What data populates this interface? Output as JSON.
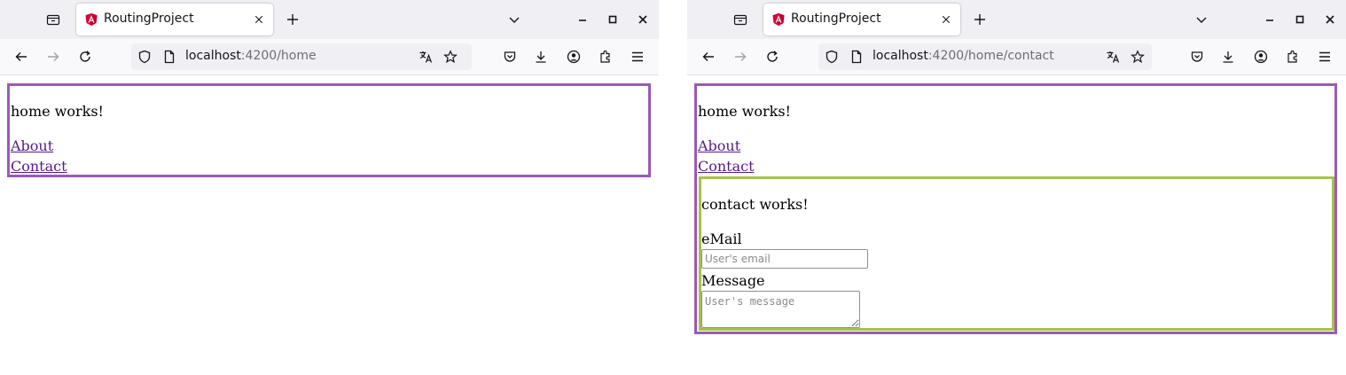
{
  "windows": [
    {
      "tab": {
        "title": "RoutingProject"
      },
      "url": {
        "host": "localhost",
        "rest": ":4200/home"
      },
      "page": {
        "home_text": "home works!",
        "links": [
          "About",
          "Contact"
        ]
      }
    },
    {
      "tab": {
        "title": "RoutingProject"
      },
      "url": {
        "host": "localhost",
        "rest": ":4200/home/contact"
      },
      "page": {
        "home_text": "home works!",
        "links": [
          "About",
          "Contact"
        ],
        "contact": {
          "title": "contact works!",
          "email_label": "eMail",
          "email_placeholder": "User's email",
          "message_label": "Message",
          "message_placeholder": "User's message"
        }
      }
    }
  ],
  "icons": {
    "tab_list": "tab-list-icon",
    "favicon": "angular-logo-icon",
    "close_tab": "close-icon",
    "new_tab": "plus-icon",
    "all_tabs": "chevron-down-icon",
    "minimize": "minimize-icon",
    "maximize": "maximize-icon",
    "close_window": "close-window-icon",
    "back": "back-arrow-icon",
    "forward": "forward-arrow-icon",
    "reload": "reload-icon",
    "shield": "shield-icon",
    "page": "page-icon",
    "translate": "translate-icon",
    "bookmark": "star-icon",
    "pocket": "pocket-icon",
    "downloads": "download-icon",
    "account": "account-icon",
    "extensions": "extensions-icon",
    "menu": "hamburger-menu-icon"
  },
  "colors": {
    "home_border": "#9b59b6",
    "contact_border": "#a5c24a",
    "visited_link": "#551a8b",
    "chrome_tabbar": "#f0f0f4",
    "chrome_toolbar": "#f9f9fb",
    "angular_red": "#dd0031",
    "angular_magenta": "#c3002f"
  }
}
